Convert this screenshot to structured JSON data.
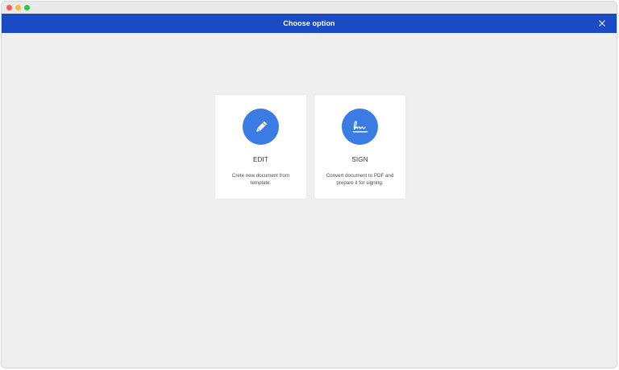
{
  "window": {
    "controls": [
      "close",
      "minimize",
      "maximize"
    ]
  },
  "header": {
    "title": "Choose option",
    "background": "#1a4bc4",
    "close_icon": "close-icon"
  },
  "options": [
    {
      "title": "EDIT",
      "description": "Crete new document from template.",
      "icon": "pencil-icon",
      "icon_color": "#3a7ce4"
    },
    {
      "title": "SIGN",
      "description": "Convert document to PDF and prepare it for signing.",
      "icon": "signature-icon",
      "icon_color": "#3a7ce4"
    }
  ]
}
